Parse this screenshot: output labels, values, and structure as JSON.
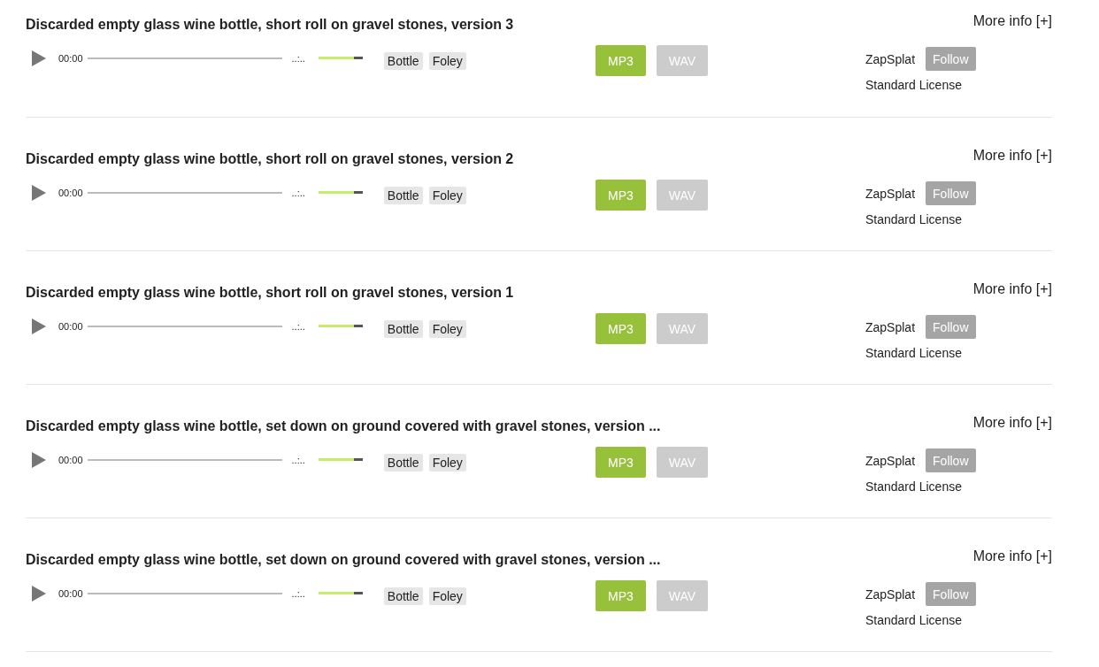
{
  "sounds": [
    {
      "title": "Discarded empty glass wine bottle, short roll on gravel stones, version 3",
      "more_info": "More info [+]",
      "time": "00:00",
      "duration": "..:..",
      "volume": {
        "level": 0.8
      },
      "tags": [
        "Bottle",
        "Foley"
      ],
      "downloads": [
        {
          "label": "MP3",
          "disabled": false
        },
        {
          "label": "WAV",
          "disabled": true
        }
      ],
      "author": "ZapSplat",
      "follow": "Follow",
      "license": "Standard License"
    },
    {
      "title": "Discarded empty glass wine bottle, short roll on gravel stones, version 2",
      "more_info": "More info [+]",
      "time": "00:00",
      "duration": "..:..",
      "volume": {
        "level": 0.8
      },
      "tags": [
        "Bottle",
        "Foley"
      ],
      "downloads": [
        {
          "label": "MP3",
          "disabled": false
        },
        {
          "label": "WAV",
          "disabled": true
        }
      ],
      "author": "ZapSplat",
      "follow": "Follow",
      "license": "Standard License"
    },
    {
      "title": "Discarded empty glass wine bottle, short roll on gravel stones, version 1",
      "more_info": "More info [+]",
      "time": "00:00",
      "duration": "..:..",
      "volume": {
        "level": 0.8
      },
      "tags": [
        "Bottle",
        "Foley"
      ],
      "downloads": [
        {
          "label": "MP3",
          "disabled": false
        },
        {
          "label": "WAV",
          "disabled": true
        }
      ],
      "author": "ZapSplat",
      "follow": "Follow",
      "license": "Standard License"
    },
    {
      "title": "Discarded empty glass wine bottle, set down on ground covered with gravel stones, version ...",
      "more_info": "More info [+]",
      "time": "00:00",
      "duration": "..:..",
      "volume": {
        "level": 0.8
      },
      "tags": [
        "Bottle",
        "Foley"
      ],
      "downloads": [
        {
          "label": "MP3",
          "disabled": false
        },
        {
          "label": "WAV",
          "disabled": true
        }
      ],
      "author": "ZapSplat",
      "follow": "Follow",
      "license": "Standard License"
    },
    {
      "title": "Discarded empty glass wine bottle, set down on ground covered with gravel stones, version ...",
      "more_info": "More info [+]",
      "time": "00:00",
      "duration": "..:..",
      "volume": {
        "level": 0.8
      },
      "tags": [
        "Bottle",
        "Foley"
      ],
      "downloads": [
        {
          "label": "MP3",
          "disabled": false
        },
        {
          "label": "WAV",
          "disabled": true
        }
      ],
      "author": "ZapSplat",
      "follow": "Follow",
      "license": "Standard License"
    }
  ]
}
